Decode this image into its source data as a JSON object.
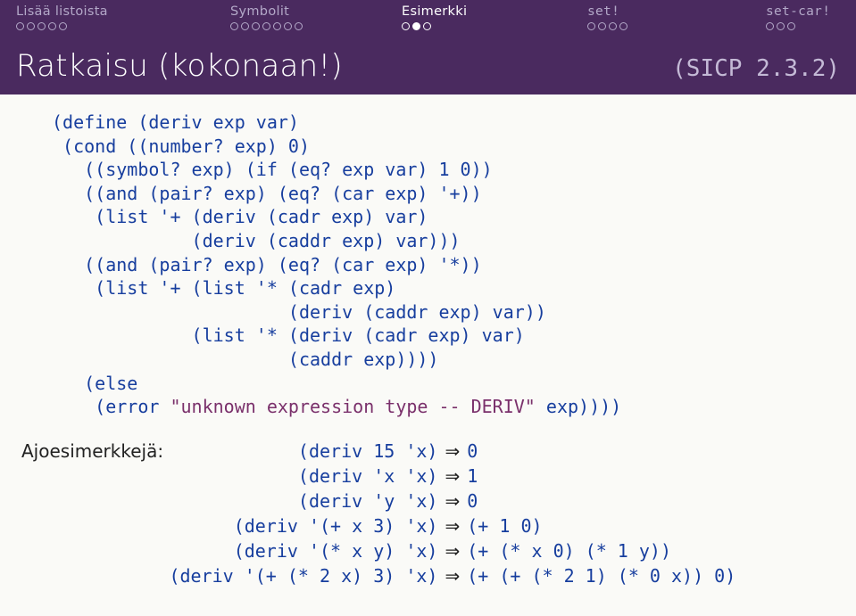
{
  "nav": [
    {
      "label": "Lisää listoista",
      "dots": 5,
      "filled": [],
      "current": false
    },
    {
      "label": "Symbolit",
      "dots": 7,
      "filled": [],
      "current": false
    },
    {
      "label": "Esimerkki",
      "dots": 3,
      "filled": [
        1
      ],
      "current": true
    },
    {
      "label": "set!",
      "dots": 4,
      "filled": [],
      "current": false,
      "mono": true
    },
    {
      "label": "set-car!",
      "dots": 3,
      "filled": [],
      "current": false,
      "mono": true
    }
  ],
  "title": {
    "text": "Ratkaisu (kokonaan!)",
    "ref": "(SICP 2.3.2)"
  },
  "code": {
    "lines": [
      "(define (deriv exp var)",
      " (cond ((number? exp) 0)",
      "   ((symbol? exp) (if (eq? exp var) 1 0))",
      "   ((and (pair? exp) (eq? (car exp) '+))",
      "    (list '+ (deriv (cadr exp) var)",
      "             (deriv (caddr exp) var)))",
      "   ((and (pair? exp) (eq? (car exp) '*))",
      "    (list '+ (list '* (cadr exp)",
      "                      (deriv (caddr exp) var))",
      "             (list '* (deriv (cadr exp) var)",
      "                      (caddr exp))))",
      "   (else",
      "    (error \"unknown expression type -- DERIV\" exp))))"
    ],
    "string_fragment": "\"unknown expression type -- DERIV\""
  },
  "examples": {
    "label": "Ajoesimerkkejä:",
    "arrow": "⇒",
    "rows": [
      {
        "call": "(deriv 15 'x)",
        "result": "0"
      },
      {
        "call": "(deriv 'x 'x)",
        "result": "1"
      },
      {
        "call": "(deriv 'y 'x)",
        "result": "0"
      },
      {
        "call": "(deriv '(+ x 3) 'x)",
        "result": "(+ 1 0)"
      },
      {
        "call": "(deriv '(* x y) 'x)",
        "result": "(+ (* x 0) (* 1 y))"
      },
      {
        "call": "(deriv '(+ (* 2 x) 3) 'x)",
        "result": "(+ (+ (* 2 1) (* 0 x)) 0)"
      }
    ]
  }
}
